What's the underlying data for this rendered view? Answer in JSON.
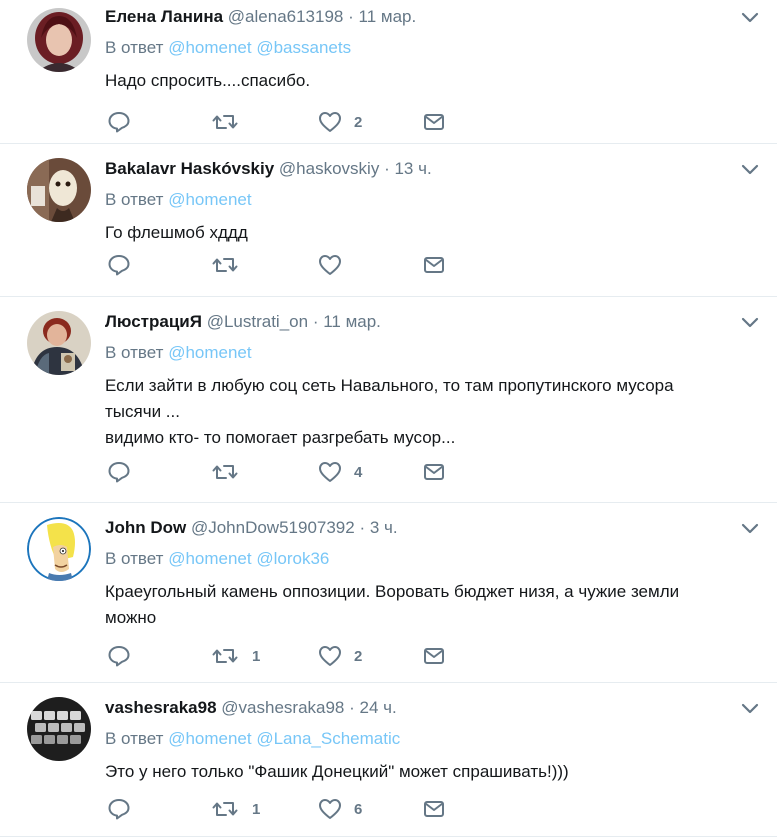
{
  "tweets": [
    {
      "name": "Елена Ланина",
      "handle": "@alena613198",
      "separator": "·",
      "time": "11 мар.",
      "reply_prefix": "В ответ",
      "mentions": [
        "@homenet",
        "@bassanets"
      ],
      "text": [
        "Надо спросить....спасибо."
      ],
      "retweets": "",
      "likes": "2"
    },
    {
      "name": "Bakalavr Haskóvskiy",
      "handle": "@haskovskiy",
      "separator": "·",
      "time": "13 ч.",
      "reply_prefix": "В ответ",
      "mentions": [
        "@homenet"
      ],
      "text": [
        "Го флешмоб хддд"
      ],
      "retweets": "",
      "likes": ""
    },
    {
      "name": "ЛюстрациЯ",
      "handle": "@Lustrati_on",
      "separator": "·",
      "time": "11 мар.",
      "reply_prefix": "В ответ",
      "mentions": [
        "@homenet"
      ],
      "text": [
        "Если зайти в любую соц сеть Навального, то там пропутинского мусора",
        "тысячи ...",
        "видимо кто- то помогает разгребать мусор..."
      ],
      "retweets": "",
      "likes": "4"
    },
    {
      "name": "John Dow",
      "handle": "@JohnDow51907392",
      "separator": "·",
      "time": "3 ч.",
      "reply_prefix": "В ответ",
      "mentions": [
        "@homenet",
        "@lorok36"
      ],
      "text": [
        "Краеугольный камень оппозиции. Воровать бюджет низя, а чужие земли",
        "можно"
      ],
      "retweets": "1",
      "likes": "2"
    },
    {
      "name": "vashesraka98",
      "handle": "@vashesraka98",
      "separator": "·",
      "time": "24 ч.",
      "reply_prefix": "В ответ",
      "mentions": [
        "@homenet",
        "@Lana_Schematic"
      ],
      "text": [
        "Это у него только \"Фашик Донецкий\" может спрашивать!)))"
      ],
      "retweets": "1",
      "likes": "6"
    }
  ],
  "icons": {
    "reply": "reply-icon",
    "retweet": "retweet-icon",
    "like": "heart-icon",
    "dm": "envelope-icon",
    "caret": "chevron-down-icon"
  },
  "colors": {
    "text": "#14171a",
    "secondary": "#657786",
    "link": "#1da1f2",
    "divider": "#e6ecf0"
  }
}
